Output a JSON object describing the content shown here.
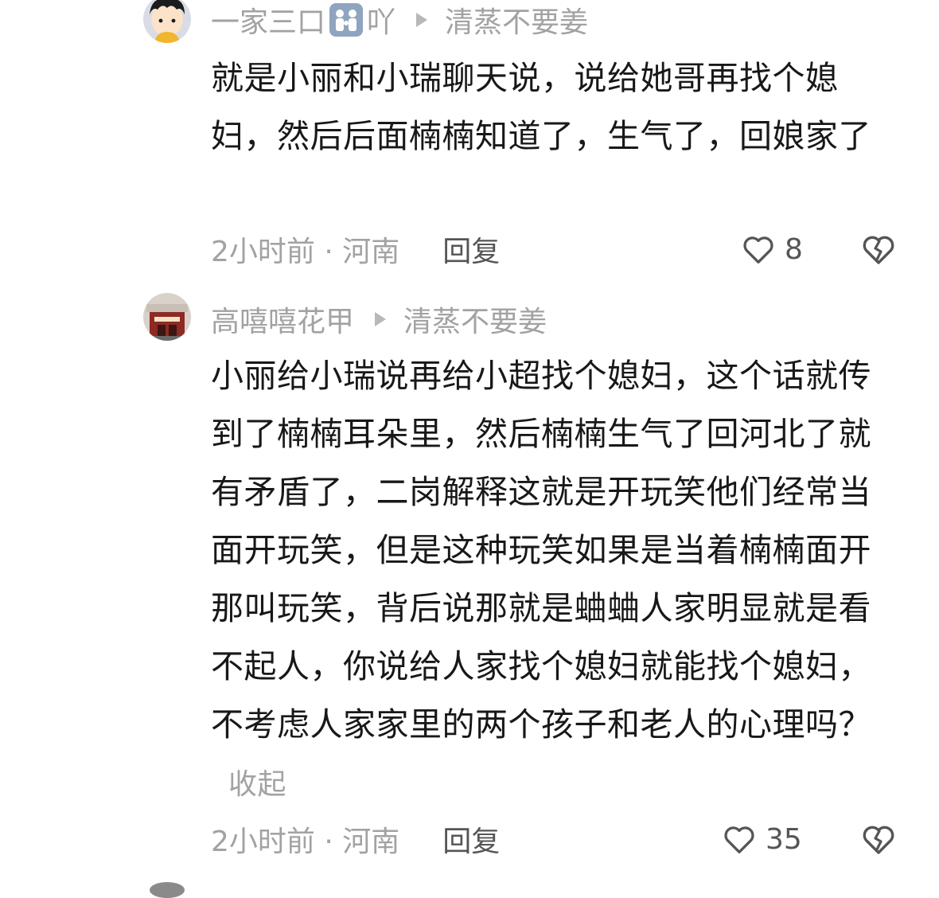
{
  "comments": [
    {
      "author": "一家三口",
      "author_suffix": "吖",
      "reply_to": "清蒸不要姜",
      "text": "就是小丽和小瑞聊天说，说给她哥再找个媳妇，然后后面楠楠知道了，生气了，回娘家了",
      "time_location": "2小时前 · 河南",
      "reply_label": "回复",
      "likes": "8",
      "collapse_label": ""
    },
    {
      "author": "高嘻嘻花甲",
      "author_suffix": "",
      "reply_to": "清蒸不要姜",
      "text": "小丽给小瑞说再给小超找个媳妇，这个话就传到了楠楠耳朵里，然后楠楠生气了回河北了就有矛盾了，二岗解释这就是开玩笑他们经常当面开玩笑，但是这种玩笑如果是当着楠楠面开那叫玩笑，背后说那就是蛐蛐人家明显就是看不起人，你说给人家找个媳妇就能找个媳妇，不考虑人家家里的两个孩子和老人的心理吗？",
      "time_location": "2小时前 · 河南",
      "reply_label": "回复",
      "likes": "35",
      "collapse_label": "收起"
    }
  ],
  "icons": {
    "like": "heart-outline-icon",
    "dislike": "broken-heart-outline-icon",
    "reply_arrow": "triangle-right-icon"
  },
  "colors": {
    "meta_gray": "#a2a2a2",
    "text": "#181818",
    "reply": "#555555"
  }
}
